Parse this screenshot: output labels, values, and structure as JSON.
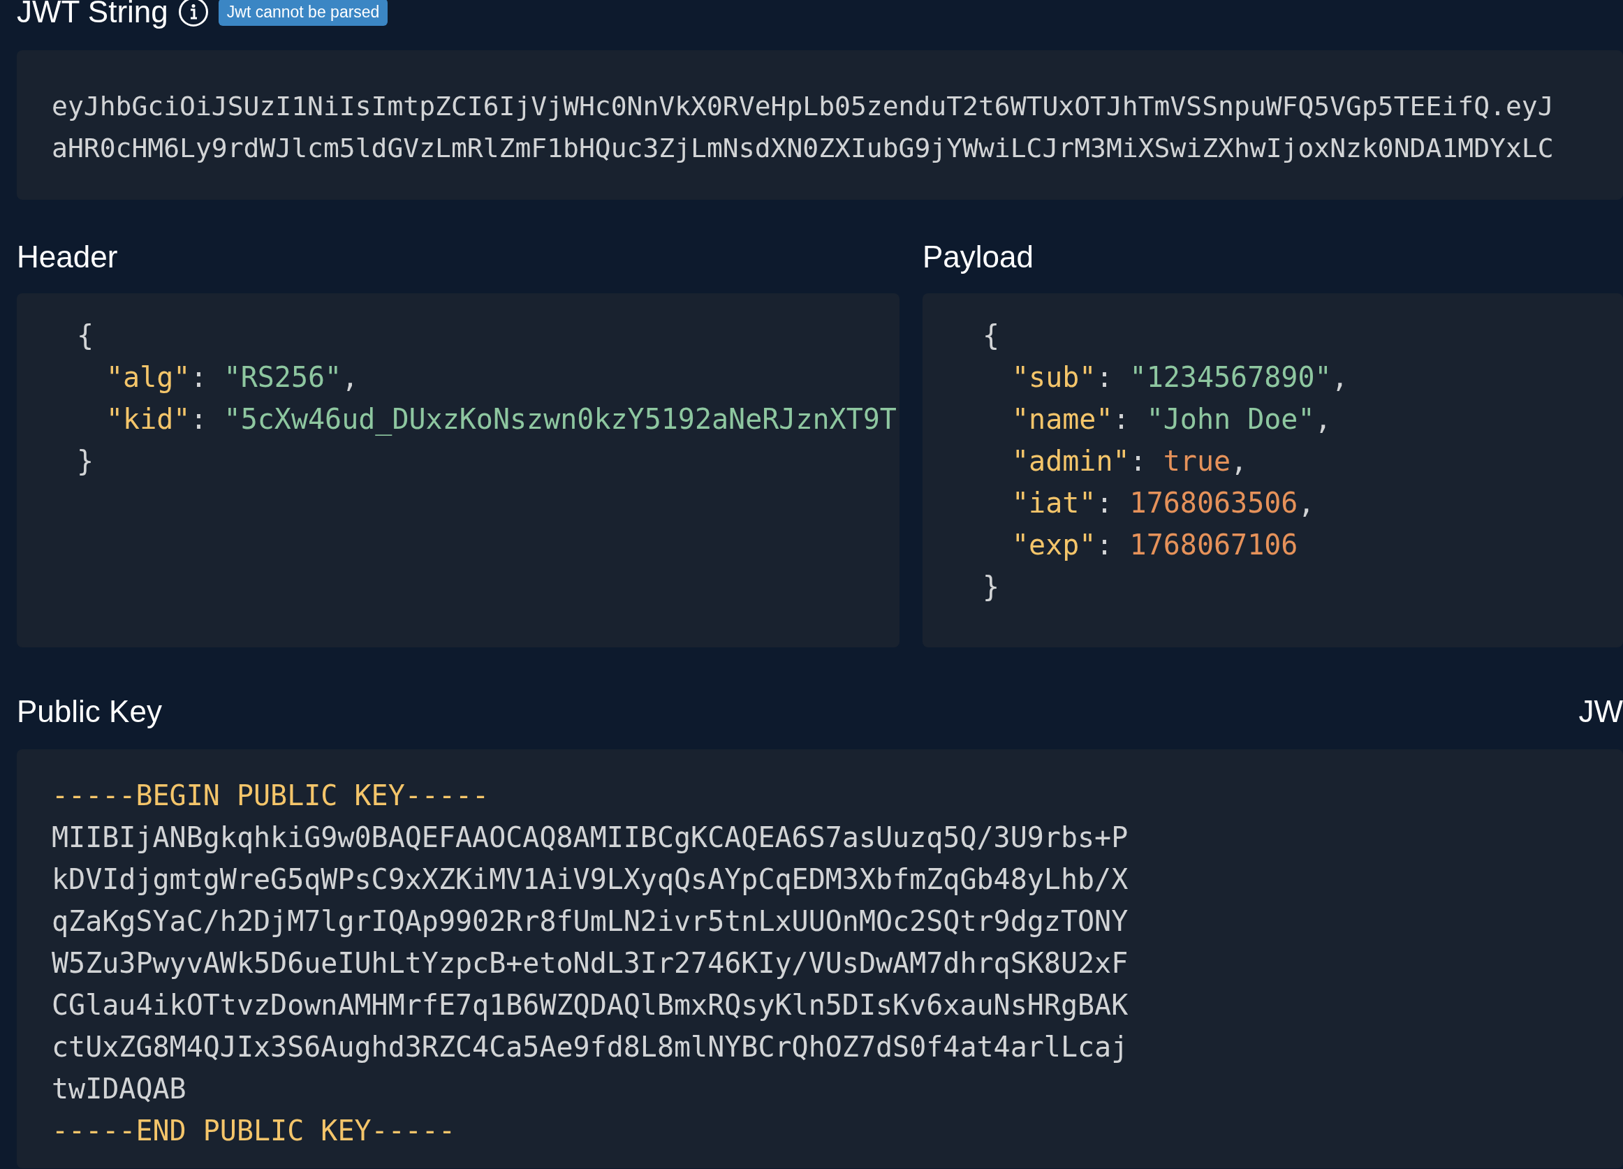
{
  "jwt_string": {
    "title": "JWT String",
    "badge": "Jwt cannot be parsed",
    "lines": [
      "eyJhbGciOiJSUzI1NiIsImtpZCI6IjVjWHc0NnVkX0RVeHpLb05zenduT2t6WTUxOTJhTmVSSnpuWFQ5VGp5TEEifQ.eyJ",
      "aHR0cHM6Ly9rdWJlcm5ldGVzLmRlZmF1bHQuc3ZjLmNsdXN0ZXIubG9jYWwiLCJrM3MiXSwiZXhwIjoxNzk0NDA1MDYxLC"
    ]
  },
  "header": {
    "title": "Header",
    "open": "{",
    "close": "}",
    "fields": [
      {
        "key": "\"alg\"",
        "sep": ": ",
        "value": "\"RS256\"",
        "kind": "string",
        "comma": ","
      },
      {
        "key": "\"kid\"",
        "sep": ": ",
        "value": "\"5cXw46ud_DUxzKoNszwn0kzY5192aNeRJznXT9T",
        "kind": "string"
      }
    ]
  },
  "payload": {
    "title": "Payload",
    "open": "{",
    "close": "}",
    "fields": [
      {
        "key": "\"sub\"",
        "sep": ": ",
        "value": "\"1234567890\"",
        "kind": "string",
        "comma": ","
      },
      {
        "key": "\"name\"",
        "sep": ": ",
        "value": "\"John Doe\"",
        "kind": "string",
        "comma": ","
      },
      {
        "key": "\"admin\"",
        "sep": ": ",
        "value": "true",
        "kind": "boolean",
        "comma": ","
      },
      {
        "key": "\"iat\"",
        "sep": ": ",
        "value": "1768063506",
        "kind": "number",
        "comma": ","
      },
      {
        "key": "\"exp\"",
        "sep": ": ",
        "value": "1768067106",
        "kind": "number"
      }
    ]
  },
  "public_key": {
    "title": "Public Key",
    "side_label": "JW",
    "lines": [
      {
        "kind": "armor",
        "text": "-----BEGIN PUBLIC KEY-----"
      },
      {
        "kind": "body",
        "text": "MIIBIjANBgkqhkiG9w0BAQEFAAOCAQ8AMIIBCgKCAQEA6S7asUuzq5Q/3U9rbs+P"
      },
      {
        "kind": "body",
        "text": "kDVIdjgmtgWreG5qWPsC9xXZKiMV1AiV9LXyqQsAYpCqEDM3XbfmZqGb48yLhb/X"
      },
      {
        "kind": "body",
        "text": "qZaKgSYaC/h2DjM7lgrIQAp9902Rr8fUmLN2ivr5tnLxUUOnMOc2SQtr9dgzTONY"
      },
      {
        "kind": "body",
        "text": "W5Zu3PwyvAWk5D6ueIUhLtYzpcB+etoNdL3Ir2746KIy/VUsDwAM7dhrqSK8U2xF"
      },
      {
        "kind": "body",
        "text": "CGlau4ikOTtvzDownAMHMrfE7q1B6WZQDAQlBmxRQsyKln5DIsKv6xauNsHRgBAK"
      },
      {
        "kind": "body",
        "text": "ctUxZG8M4QJIx3S6Aughd3RZC4Ca5Ae9fd8L8mlNYBCrQhOZ7dS0f4at4arlLcaj"
      },
      {
        "kind": "body",
        "text": "twIDAQAB"
      },
      {
        "kind": "armor",
        "text": "-----END PUBLIC KEY-----"
      }
    ]
  }
}
